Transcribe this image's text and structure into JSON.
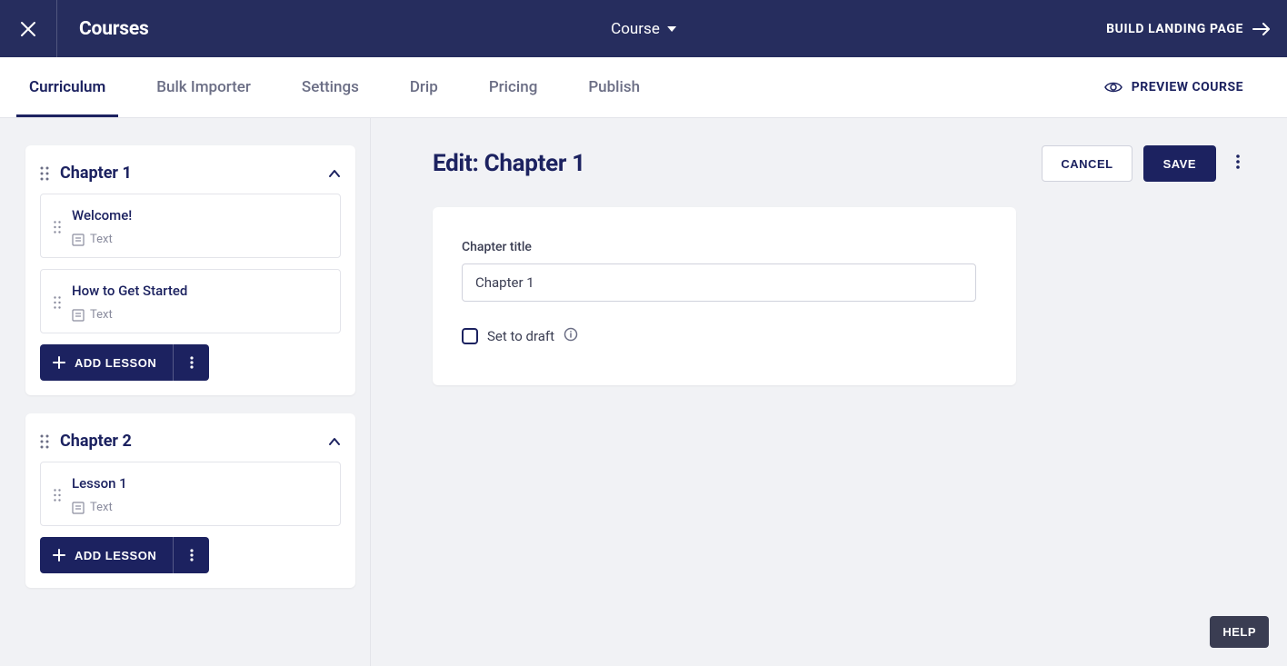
{
  "header": {
    "title": "Courses",
    "dropdown_label": "Course",
    "build_button": "BUILD LANDING PAGE"
  },
  "tabs": {
    "items": [
      {
        "label": "Curriculum",
        "active": true
      },
      {
        "label": "Bulk Importer",
        "active": false
      },
      {
        "label": "Settings",
        "active": false
      },
      {
        "label": "Drip",
        "active": false
      },
      {
        "label": "Pricing",
        "active": false
      },
      {
        "label": "Publish",
        "active": false
      }
    ],
    "preview_button": "PREVIEW COURSE"
  },
  "sidebar": {
    "chapters": [
      {
        "title": "Chapter 1",
        "lessons": [
          {
            "title": "Welcome!",
            "type": "Text"
          },
          {
            "title": "How to Get Started",
            "type": "Text"
          }
        ],
        "add_button": "ADD LESSON"
      },
      {
        "title": "Chapter 2",
        "lessons": [
          {
            "title": "Lesson 1",
            "type": "Text"
          }
        ],
        "add_button": "ADD LESSON"
      }
    ]
  },
  "edit": {
    "heading": "Edit: Chapter 1",
    "cancel_label": "CANCEL",
    "save_label": "SAVE",
    "field_label": "Chapter title",
    "field_value": "Chapter 1",
    "draft_label": "Set to draft"
  },
  "help": {
    "label": "HELP"
  }
}
